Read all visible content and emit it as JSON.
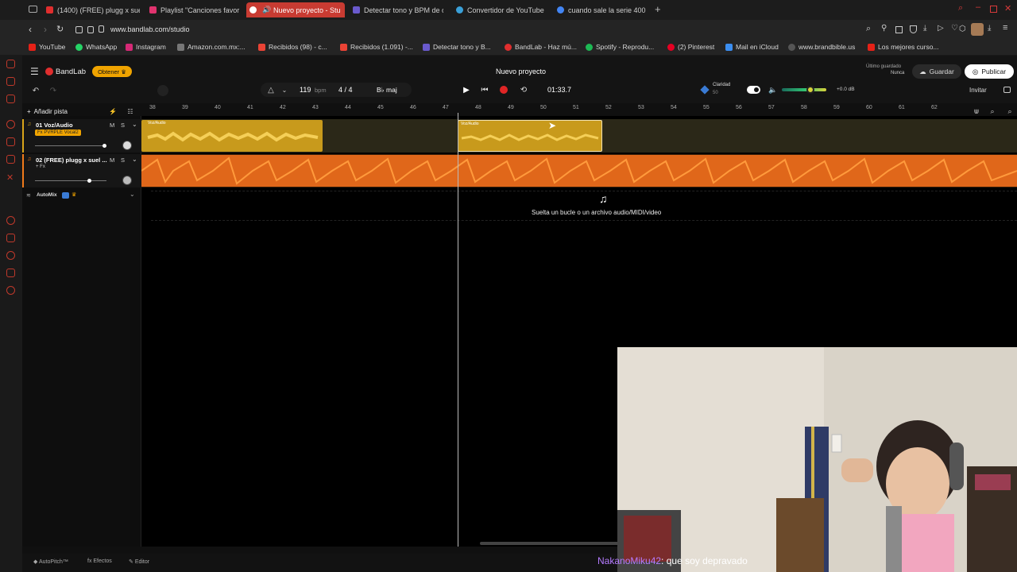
{
  "browser": {
    "tabs": [
      {
        "label": "(1400) (FREE) plugg x sue",
        "color": "#e02e2e"
      },
      {
        "label": "Playlist \"Canciones favor",
        "color": "#e0336e"
      },
      {
        "label": "Nuevo proyecto - Stu",
        "color": "#ffffff",
        "active": true
      },
      {
        "label": "Detectar tono y BPM de c",
        "color": "#6a5acd"
      },
      {
        "label": "Convertidor de YouTube",
        "color": "#3aa0d8"
      },
      {
        "label": "cuando sale la serie 400",
        "color": "#4285f4"
      }
    ],
    "url": "www.bandlab.com/studio",
    "bookmarks": [
      {
        "label": "YouTube",
        "color": "#e62117"
      },
      {
        "label": "WhatsApp",
        "color": "#25d366"
      },
      {
        "label": "Instagram",
        "color": "#d62976"
      },
      {
        "label": "Amazon.com.mx:...",
        "color": "#333333"
      },
      {
        "label": "Recibidos (98) - c...",
        "color": "#ea4335"
      },
      {
        "label": "Recibidos (1.091) -...",
        "color": "#ea4335"
      },
      {
        "label": "Detectar tono y B...",
        "color": "#6a5acd"
      },
      {
        "label": "BandLab - Haz mú...",
        "color": "#e02e2e"
      },
      {
        "label": "Spotify - Reprodu...",
        "color": "#1db954"
      },
      {
        "label": "(2) Pinterest",
        "color": "#e60023"
      },
      {
        "label": "Mail en iCloud",
        "color": "#3b8ef0"
      },
      {
        "label": "www.brandbible.us",
        "color": "#555555"
      },
      {
        "label": "Los mejores curso...",
        "color": "#e62117"
      }
    ]
  },
  "app": {
    "brand": "BandLab",
    "get_button": "Obtener",
    "project_title": "Nuevo proyecto",
    "last_saved_label": "Último guardado",
    "last_saved_value": "Nunca",
    "save_button": "Guardar",
    "publish_button": "Publicar",
    "invite_button": "Invitar",
    "bpm_value": "119",
    "bpm_unit": "bpm",
    "time_signature": "4 / 4",
    "key": "B♭ maj",
    "time_display": "01:33.7",
    "clarity_label": "Claridad",
    "clarity_value": "50",
    "volume_db": "+0.0 dB",
    "add_track": "Añadir pista",
    "tracks": [
      {
        "name": "01 Voz/Audio",
        "fx": "Fx PVRPLE Vocal2",
        "mute": "M",
        "solo": "S"
      },
      {
        "name": "02 (FREE) plugg x suel ...",
        "fx": "+ Fx",
        "mute": "M",
        "solo": "S"
      }
    ],
    "automix_label": "AutoMix",
    "clip_label_1": "Voz/Audio",
    "clip_label_2": "Voz/Audio",
    "drop_hint": "Suelta un bucle o un archivo audio/MIDI/video",
    "ruler_ticks": [
      "38",
      "39",
      "40",
      "41",
      "42",
      "43",
      "44",
      "45",
      "46",
      "47",
      "48",
      "49",
      "50",
      "51",
      "52",
      "53",
      "54",
      "55",
      "56",
      "57",
      "58",
      "59",
      "60",
      "61",
      "62"
    ],
    "bottom": {
      "autopitch": "AutoPitch™",
      "effects": "Efectos",
      "editor": "Editor"
    }
  },
  "stream": {
    "chat_user": "NakanoMiku42",
    "chat_message": ": que soy depravado"
  },
  "colors": {
    "accent": "#f0a400",
    "vocal_track": "#d9a419",
    "beat_track": "#f07a1a",
    "record": "#e02525"
  }
}
